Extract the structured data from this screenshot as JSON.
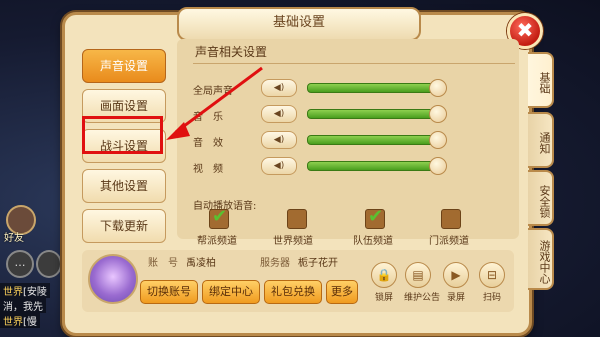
{
  "dialog": {
    "title": "基础设置",
    "close_label": "✖"
  },
  "menu": {
    "items": [
      {
        "label": "声音设置",
        "active": true
      },
      {
        "label": "画面设置",
        "active": false
      },
      {
        "label": "战斗设置",
        "active": false
      },
      {
        "label": "其他设置",
        "active": false
      },
      {
        "label": "下载更新",
        "active": false
      }
    ]
  },
  "panel": {
    "section_title": "声音相关设置",
    "rows": [
      {
        "label": "全局声音",
        "level": 0.98
      },
      {
        "label": "音　乐",
        "level": 0.98
      },
      {
        "label": "音　效",
        "level": 0.98
      },
      {
        "label": "视　频",
        "level": 0.98
      }
    ],
    "auto_voice_label": "自动播放语音:",
    "channels": [
      {
        "label": "帮派频道",
        "checked": true
      },
      {
        "label": "世界频道",
        "checked": false
      },
      {
        "label": "队伍频道",
        "checked": true
      },
      {
        "label": "门派频道",
        "checked": false
      }
    ]
  },
  "side_tabs": [
    {
      "label": "基础",
      "active": true
    },
    {
      "label": "通知",
      "active": false
    },
    {
      "label": "安全锁",
      "active": false
    },
    {
      "label": "游戏中心",
      "active": false
    }
  ],
  "account": {
    "account_label": "账　号",
    "account_value": "禹凌柏",
    "server_label": "服务器",
    "server_value": "栀子花开",
    "buttons": [
      "切换账号",
      "绑定中心",
      "礼包兑换",
      "更多"
    ],
    "functions": [
      {
        "label": "锁屏",
        "icon": "lock-icon"
      },
      {
        "label": "维护公告",
        "icon": "notice-icon"
      },
      {
        "label": "录屏",
        "icon": "record-icon"
      },
      {
        "label": "扫码",
        "icon": "scan-icon"
      }
    ]
  },
  "background": {
    "friend_label": "好友",
    "chat_lines": [
      {
        "tag": "世界",
        "text": "[安陵"
      },
      {
        "tag": "",
        "text": "消，我先"
      },
      {
        "tag": "世界",
        "text": "[慢"
      }
    ]
  },
  "colors": {
    "active_orange": "#f09b1f",
    "slider_green": "#6ac030",
    "highlight_red": "#e01010"
  }
}
